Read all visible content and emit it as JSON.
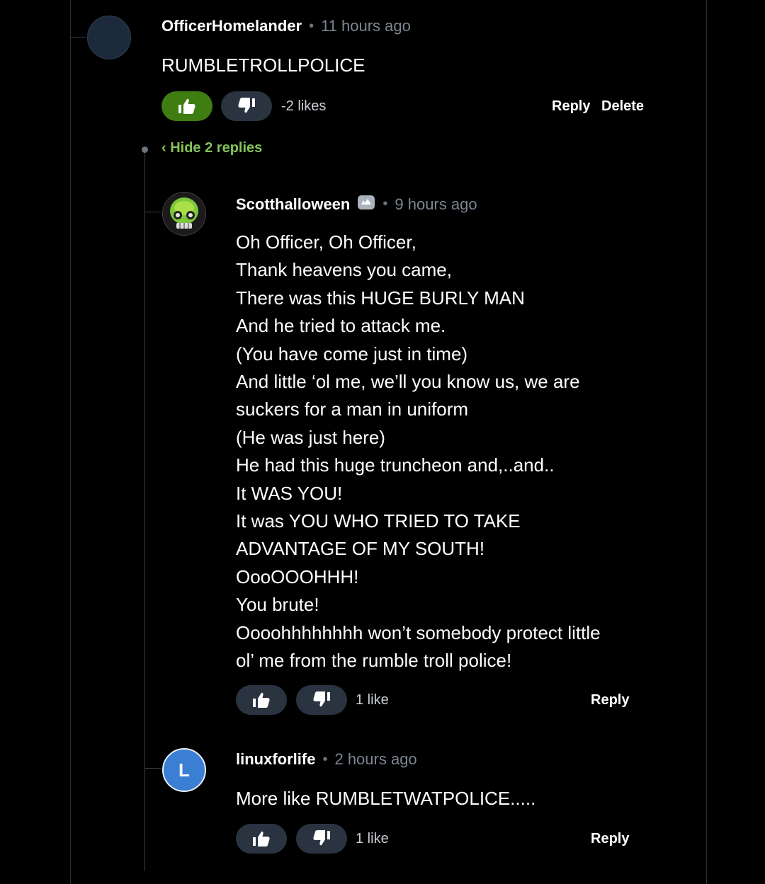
{
  "comments": [
    {
      "username": "OfficerHomelander",
      "time": "11 hours ago",
      "body": [
        "RUMBLETROLLPOLICE"
      ],
      "likes": "-2 likes",
      "actions": [
        "Reply",
        "Delete"
      ],
      "upvote_active": true
    }
  ],
  "hide_replies_label": "‹ Hide 2 replies",
  "replies": [
    {
      "username": "Scotthalloween",
      "verified_badge_icon": "verified-badge-icon",
      "time": "9 hours ago",
      "body": [
        "Oh Officer, Oh Officer,",
        "Thank heavens you came,",
        "There was this HUGE BURLY MAN",
        "And he tried to attack me.",
        "(You have come just in time)",
        "And little ‘ol me, we’ll you know us, we are",
        "suckers for a man in uniform",
        "(He was just here)",
        "He had this huge truncheon and,..and..",
        "It WAS YOU!",
        "It was YOU WHO TRIED TO TAKE",
        "ADVANTAGE OF MY SOUTH!",
        "OooOOOHHH!",
        "You brute!",
        "Oooohhhhhhhh won’t somebody protect little",
        "ol’ me from the rumble troll police!"
      ],
      "likes": "1 like",
      "actions": [
        "Reply"
      ]
    },
    {
      "username": "linuxforlife",
      "avatar_letter": "L",
      "avatar_color": "#3b7fd4",
      "time": "2 hours ago",
      "body": [
        "More like RUMBLETWATPOLICE....."
      ],
      "likes": "1 like",
      "actions": [
        "Reply"
      ]
    }
  ],
  "colors": {
    "background": "#000000",
    "upvote_active": "#3f7d12",
    "vote_button": "#2a3441",
    "hide_replies": "#84c35a",
    "muted": "#7d8591"
  }
}
